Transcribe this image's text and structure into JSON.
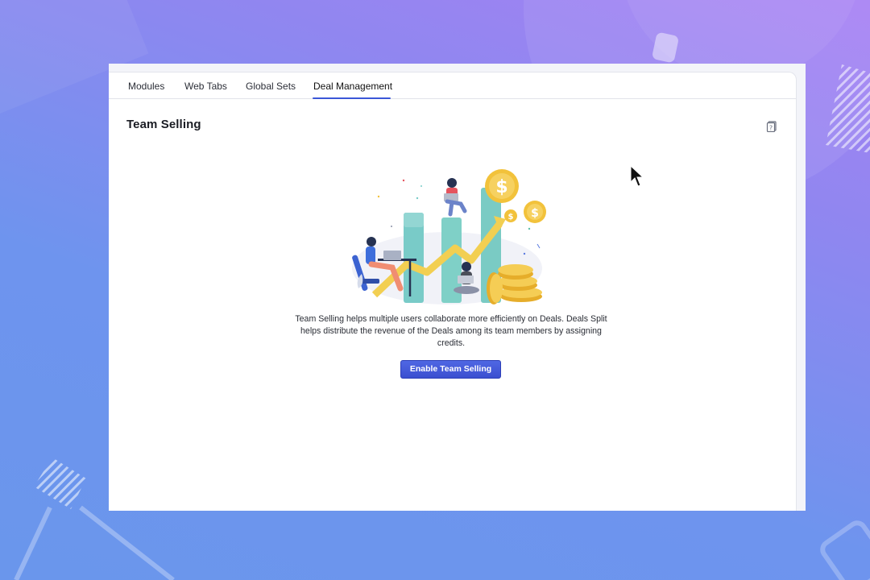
{
  "tabs": [
    {
      "label": "Modules"
    },
    {
      "label": "Web Tabs"
    },
    {
      "label": "Global Sets"
    },
    {
      "label": "Deal Management",
      "active": true
    }
  ],
  "page": {
    "title": "Team Selling",
    "help_icon": "help-book-icon",
    "description": "Team Selling helps multiple users collaborate more efficiently on Deals. Deals Split helps distribute the revenue of the Deals among its team members by assigning credits.",
    "illustration": "team-selling-illustration",
    "enable_button_label": "Enable Team Selling"
  },
  "colors": {
    "accent": "#3b57d8",
    "button": "#4257d8",
    "background_top": "#a781f3",
    "background_bottom": "#6a96ec"
  },
  "cursor_icon": "arrow-cursor-icon"
}
